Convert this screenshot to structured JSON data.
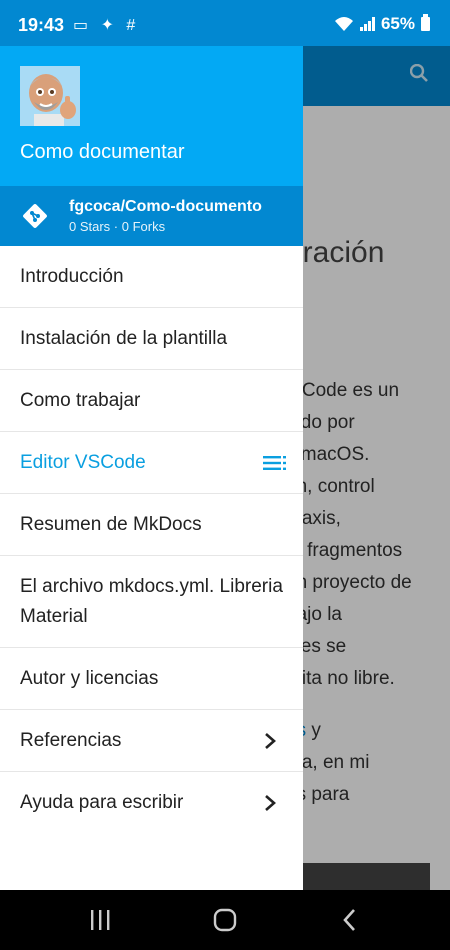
{
  "status_bar": {
    "time": "19:43",
    "left_icons": "▭ ✦ #",
    "battery": "65%"
  },
  "background_page": {
    "heading": "uración",
    "lines": [
      "o Code es un",
      "lado por",
      "y macOS.",
      "ón, control",
      "ntaxis,",
      "o, fragmentos",
      "un proyecto de",
      "bajo la",
      "bles se",
      "tuita no libre."
    ],
    "link_text": "os",
    "after_link": " y",
    "lines2": [
      "ma, en mi",
      "os para"
    ]
  },
  "drawer": {
    "title": "Como documentar",
    "repo": {
      "name": "fgcoca/Como-documento",
      "facts": "0 Stars · 0 Forks"
    },
    "items": [
      {
        "label": "Introducción"
      },
      {
        "label": "Instalación de la plantilla"
      },
      {
        "label": "Como trabajar"
      },
      {
        "label": "Editor VSCode"
      },
      {
        "label": "Resumen de MkDocs"
      },
      {
        "label": "El archivo mkdocs.yml. Libreria Material"
      },
      {
        "label": "Autor y licencias"
      },
      {
        "label": "Referencias"
      },
      {
        "label": "Ayuda para escribir"
      }
    ]
  },
  "colors": {
    "primary": "#0288d1",
    "header": "#03a9f4",
    "active": "#0a9fe0"
  }
}
